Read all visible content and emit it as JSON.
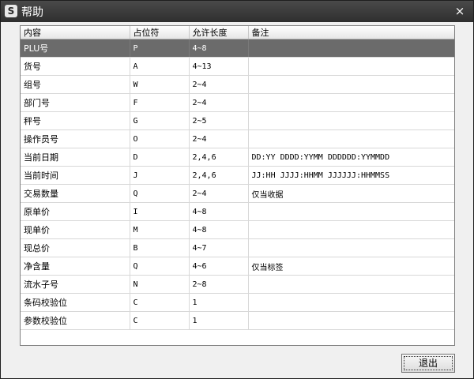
{
  "window": {
    "title": "帮助",
    "close_label": "×"
  },
  "table": {
    "headers": [
      "内容",
      "占位符",
      "允许长度",
      "备注"
    ],
    "rows": [
      [
        "PLU号",
        "P",
        "4~8",
        ""
      ],
      [
        "货号",
        "A",
        "4~13",
        ""
      ],
      [
        "组号",
        "W",
        "2~4",
        ""
      ],
      [
        "部门号",
        "F",
        "2~4",
        ""
      ],
      [
        "秤号",
        "G",
        "2~5",
        ""
      ],
      [
        "操作员号",
        "O",
        "2~4",
        ""
      ],
      [
        "当前日期",
        "D",
        "2,4,6",
        "DD:YY  DDDD:YYMM  DDDDDD:YYMMDD"
      ],
      [
        "当前时间",
        "J",
        "2,4,6",
        "JJ:HH  JJJJ:HHMM  JJJJJJ:HHMMSS"
      ],
      [
        "交易数量",
        "Q",
        "2~4",
        "仅当收据"
      ],
      [
        "原单价",
        "I",
        "4~8",
        ""
      ],
      [
        "现单价",
        "M",
        "4~8",
        ""
      ],
      [
        "现总价",
        "B",
        "4~7",
        ""
      ],
      [
        "净含量",
        "Q",
        "4~6",
        "仅当标签"
      ],
      [
        "流水子号",
        "N",
        "2~8",
        ""
      ],
      [
        "条码校验位",
        "C",
        "1",
        ""
      ],
      [
        "参数校验位",
        "C",
        "1",
        ""
      ]
    ],
    "selected_row": 0
  },
  "buttons": {
    "exit_label": "退出"
  },
  "colors": {
    "titlebar": "#3a3a3a",
    "selected_row": "#6b6b6b"
  }
}
